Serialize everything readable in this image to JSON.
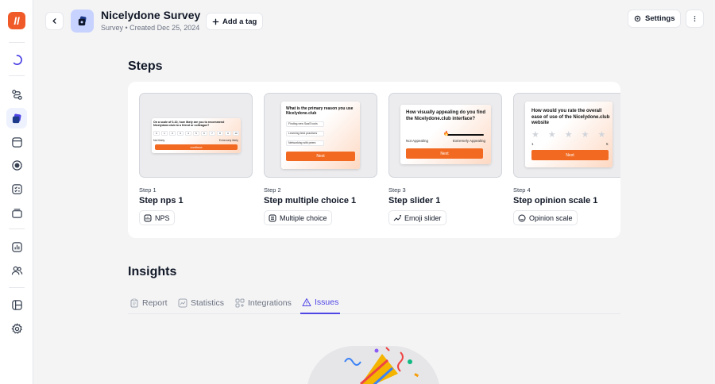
{
  "app": {
    "logo_letter": "ll"
  },
  "sidebar": {
    "items": [
      {
        "icon": "loader-icon"
      },
      {
        "icon": "route-icon"
      },
      {
        "icon": "surveys-icon",
        "active": true
      },
      {
        "icon": "window-icon"
      },
      {
        "icon": "target-icon"
      },
      {
        "icon": "checklist-icon"
      },
      {
        "icon": "stack-icon"
      },
      {
        "icon": "analytics-icon"
      },
      {
        "icon": "users-icon"
      },
      {
        "icon": "layout-icon"
      },
      {
        "icon": "settings-icon"
      }
    ]
  },
  "header": {
    "title": "Nicelydone Survey",
    "subtitle": "Survey • Created Dec 25, 2024",
    "add_tag_label": "Add a tag",
    "settings_label": "Settings"
  },
  "steps": {
    "heading": "Steps",
    "items": [
      {
        "number": "Step 1",
        "name": "Step nps 1",
        "badge": "NPS",
        "preview": {
          "question": "On a scale of 0-10, how likely are you to recommend Nicelydone.club to a friend or colleague?",
          "scale": [
            "0",
            "1",
            "2",
            "3",
            "4",
            "5",
            "6",
            "7",
            "8",
            "9",
            "10"
          ],
          "low": "Not likely",
          "high": "Extremely likely",
          "button": "continue"
        }
      },
      {
        "number": "Step 2",
        "name": "Step multiple choice 1",
        "badge": "Multiple choice",
        "preview": {
          "question": "What is the primary reason you use Nicelydone.club",
          "options": [
            "Finding new SaaS tools",
            "Learning best practices",
            "Networking with peers"
          ],
          "button": "Next"
        }
      },
      {
        "number": "Step 3",
        "name": "Step slider 1",
        "badge": "Emoji slider",
        "preview": {
          "question": "How visually appealing do you find the Nicelydone.club interface?",
          "low": "Not Appealing",
          "high": "Extremely Appealing",
          "button": "Next"
        }
      },
      {
        "number": "Step 4",
        "name": "Step opinion scale 1",
        "badge": "Opinion scale",
        "preview": {
          "question": "How would you rate the overall ease of use of the Nicelydone.club website",
          "low": "1",
          "high": "5",
          "button": "Next"
        }
      }
    ]
  },
  "insights": {
    "heading": "Insights",
    "tabs": [
      {
        "label": "Report",
        "icon": "clipboard-icon"
      },
      {
        "label": "Statistics",
        "icon": "chart-icon"
      },
      {
        "label": "Integrations",
        "icon": "grid-icon"
      },
      {
        "label": "Issues",
        "icon": "warning-icon",
        "active": true
      }
    ]
  },
  "colors": {
    "accent": "#4f46e5",
    "brand": "#f05a28",
    "cta": "#f26a21"
  }
}
